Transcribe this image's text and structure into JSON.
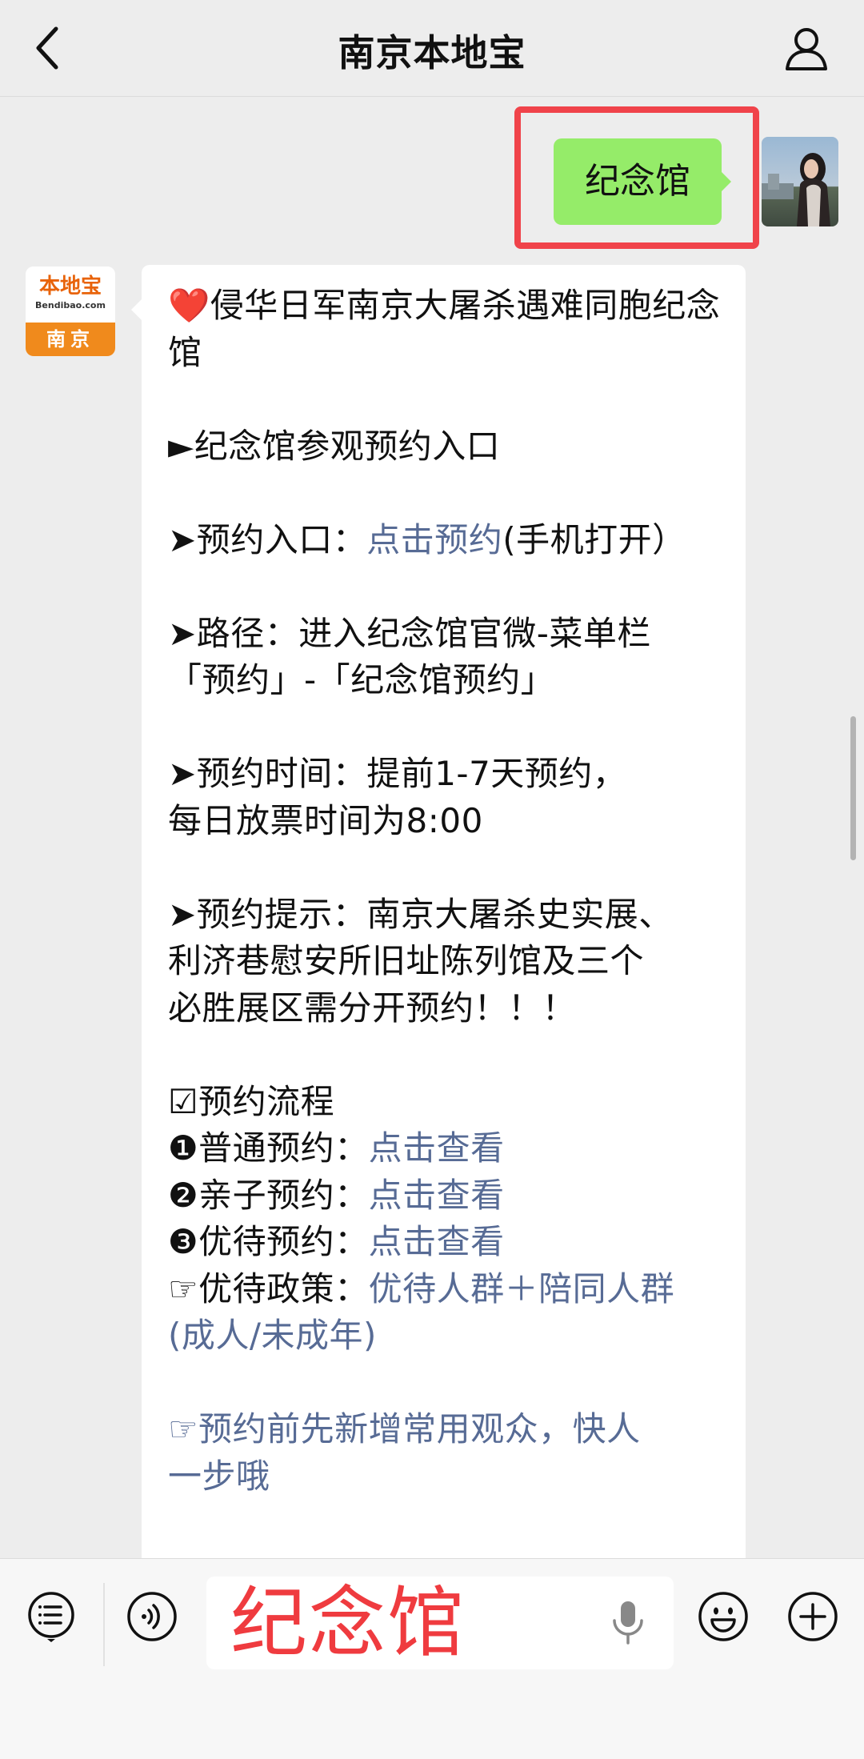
{
  "header": {
    "title": "南京本地宝"
  },
  "sent_message": {
    "text": "纪念馆"
  },
  "bot_avatar": {
    "brand": "本地宝",
    "domain": "Bendibao.com",
    "city": "南京"
  },
  "received_message": {
    "heading_emoji": "❤️",
    "heading": "侵华日军南京大屠杀遇难同胞纪念馆",
    "section_title": "►纪念馆参观预约入口",
    "entry_prefix": "➤预约入口：",
    "entry_link": "点击预约",
    "entry_suffix": "(手机打开）",
    "path_line1": "➤路径：进入纪念馆官微-菜单栏",
    "path_line2": "「预约」-「纪念馆预约」",
    "time_line1": "➤预约时间：提前1-7天预约，",
    "time_line2": "每日放票时间为8:00",
    "tip_line1": "➤预约提示：南京大屠杀史实展、",
    "tip_line2": "利济巷慰安所旧址陈列馆及三个",
    "tip_line3": "必胜展区需分开预约！！！",
    "flow_title": "☑预约流程",
    "flow_items": [
      {
        "label": "❶普通预约：",
        "link": "点击查看"
      },
      {
        "label": "❷亲子预约：",
        "link": "点击查看"
      },
      {
        "label": "❸优待预约：",
        "link": "点击查看"
      }
    ],
    "policy_label": "☞优待政策：",
    "policy_link_line1": "优待人群＋陪同人群",
    "policy_link_line2": "(成人/未成年)",
    "audience_link_line1": "☞预约前先新增常用观众，快人",
    "audience_link_line2": "一步哦"
  },
  "input_bar": {
    "value": "纪念馆"
  },
  "colors": {
    "sent_bubble": "#95ec69",
    "link": "#576b95",
    "highlight": "#f0434a",
    "input_text": "#ef3b3f",
    "brand_orange": "#f08a1c"
  },
  "icons": [
    "back-icon",
    "profile-icon",
    "menu-icon",
    "voice-icon",
    "mic-icon",
    "emoji-icon",
    "plus-icon"
  ]
}
